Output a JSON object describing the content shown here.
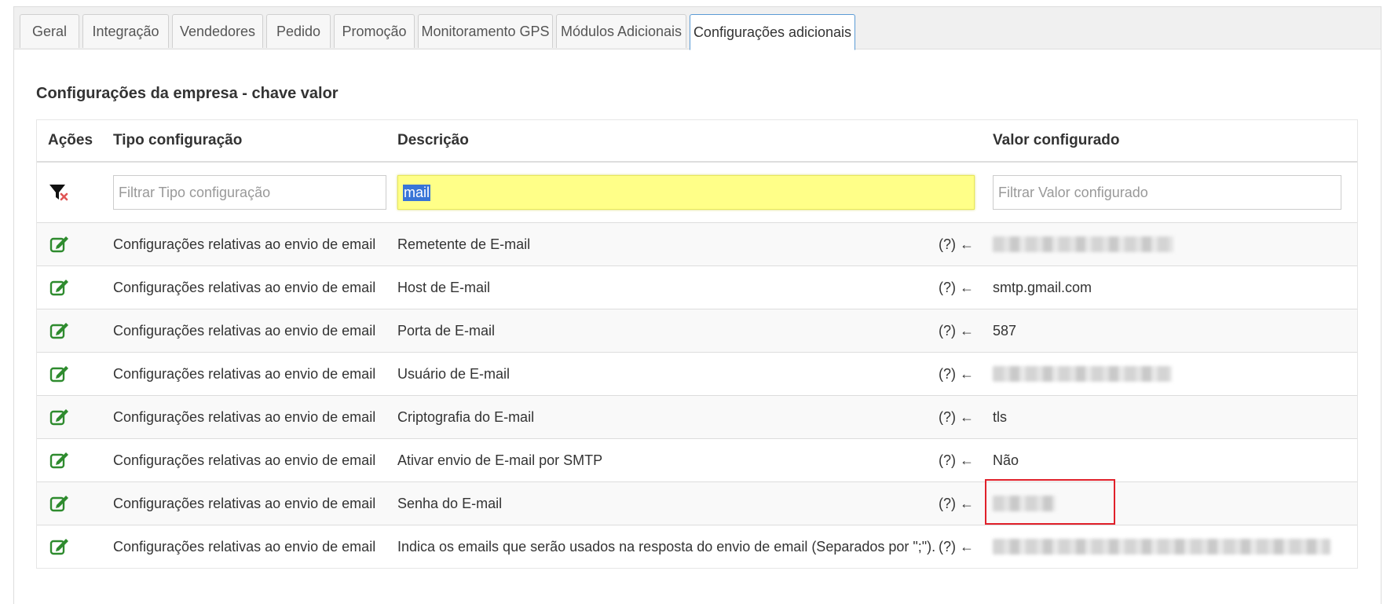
{
  "tabs": [
    {
      "label": "Geral"
    },
    {
      "label": "Integração"
    },
    {
      "label": "Vendedores"
    },
    {
      "label": "Pedido"
    },
    {
      "label": "Promoção"
    },
    {
      "label": "Monitoramento GPS"
    },
    {
      "label": "Módulos Adicionais"
    },
    {
      "label": "Configurações adicionais",
      "active": true
    }
  ],
  "section": {
    "title": "Configurações da empresa - chave valor"
  },
  "table": {
    "headers": {
      "acoes": "Ações",
      "tipo": "Tipo configuração",
      "descricao": "Descrição",
      "valor": "Valor configurado"
    },
    "filters": {
      "tipo_placeholder": "Filtrar Tipo configuração",
      "descricao_value": "mail",
      "valor_placeholder": "Filtrar Valor configurado",
      "clear_icon": "filter-clear-icon"
    },
    "help_text": "(?) ←",
    "rows": [
      {
        "tipo": "Configurações relativas ao envio de email",
        "descricao": "Remetente de E-mail",
        "valor": "",
        "blurred": true
      },
      {
        "tipo": "Configurações relativas ao envio de email",
        "descricao": "Host de E-mail",
        "valor": "smtp.gmail.com"
      },
      {
        "tipo": "Configurações relativas ao envio de email",
        "descricao": "Porta de E-mail",
        "valor": "587"
      },
      {
        "tipo": "Configurações relativas ao envio de email",
        "descricao": "Usuário de E-mail",
        "valor": "",
        "blurred": true
      },
      {
        "tipo": "Configurações relativas ao envio de email",
        "descricao": "Criptografia do E-mail",
        "valor": "tls"
      },
      {
        "tipo": "Configurações relativas ao envio de email",
        "descricao": "Ativar envio de E-mail por SMTP",
        "valor": "Não"
      },
      {
        "tipo": "Configurações relativas ao envio de email",
        "descricao": "Senha do E-mail",
        "valor": "",
        "blurred": true
      },
      {
        "tipo": "Configurações relativas ao envio de email",
        "descricao": "Indica os emails que serão usados na resposta do envio de email (Separados por \";\").",
        "valor": "",
        "blurred": true
      }
    ]
  },
  "colors": {
    "accent": "#5b9bd5",
    "edit_icon": "#2e8b2e",
    "highlight": "#ffff88",
    "annotation": "#e0202a"
  }
}
